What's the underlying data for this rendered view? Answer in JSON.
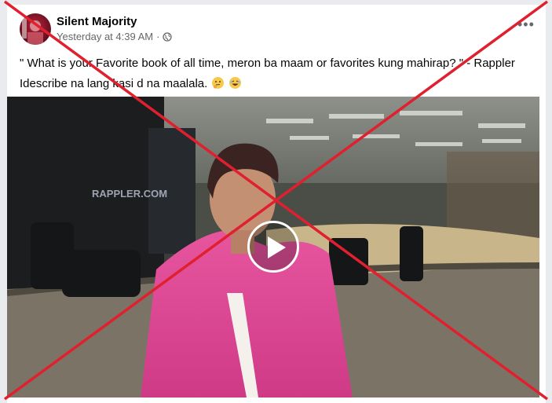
{
  "post": {
    "author": "Silent Majority",
    "timestamp": "Yesterday at 4:39 AM",
    "separator": "·",
    "privacy_icon": "globe-icon",
    "more_icon": "more-options-icon",
    "caption_line1": "\" What is your Favorite book of all time, meron ba maam or favorites kung mahirap? \" - Rappler",
    "caption_line2": "Idescribe na lang kasi d na maalala.",
    "caption_emojis": [
      "thinking-face-emoji",
      "laughing-face-emoji"
    ]
  },
  "video": {
    "play_icon": "play-icon",
    "background_sign": "RAPPLER.COM"
  },
  "overlay": {
    "mark": "red-x-cross",
    "color": "#e0202e"
  }
}
